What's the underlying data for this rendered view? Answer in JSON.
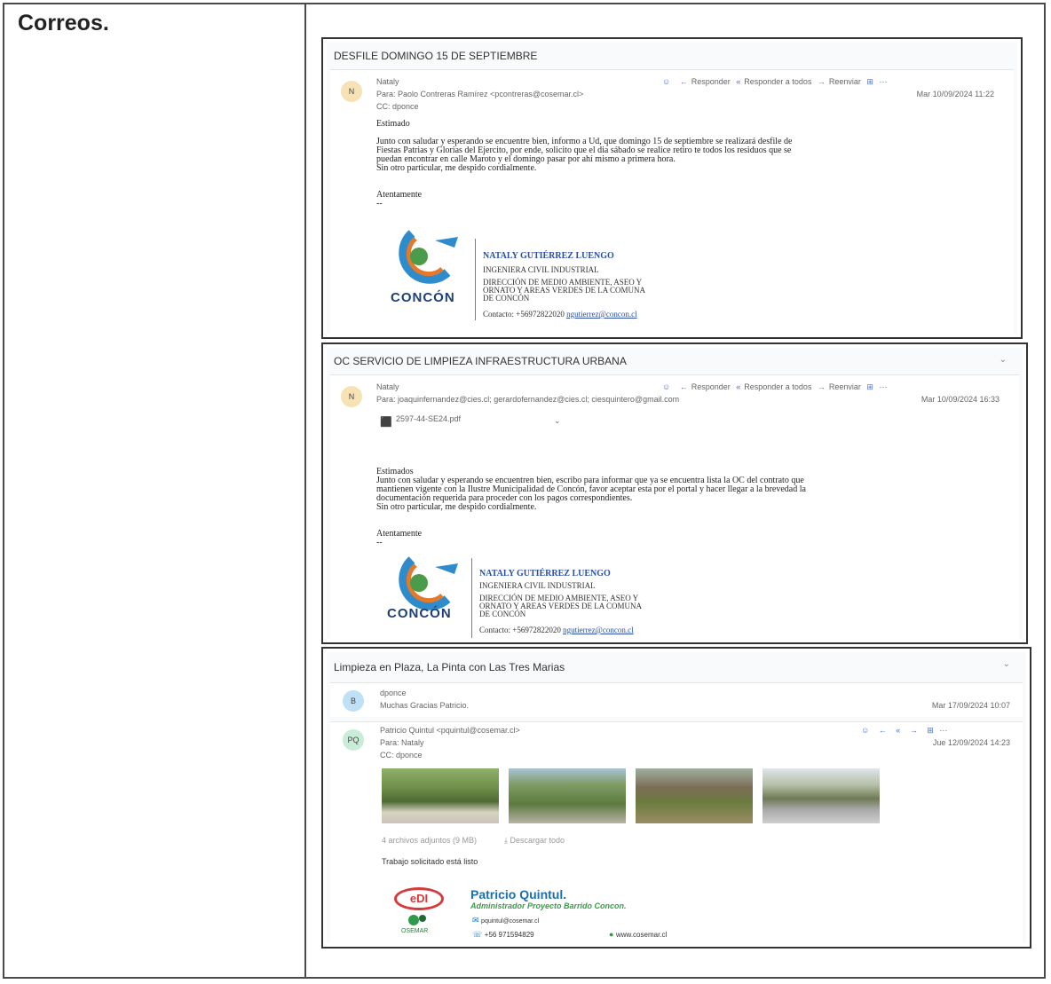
{
  "section_title": "Correos.",
  "email1": {
    "subject": "DESFILE DOMINGO 15 DE SEPTIEMBRE",
    "avatar": "N",
    "sender": "Nataly",
    "to": "Para: Paolo Contreras Ramírez <pcontreras@cosemar.cl>",
    "cc": "CC: dponce",
    "actions": [
      "Responder",
      "Responder a todos",
      "Reenviar"
    ],
    "date": "Mar 10/09/2024 11:22",
    "greeting": "Estimado",
    "body": [
      "Junto con saludar y esperando se encuentre bien, informo a Ud, que domingo 15 de septiembre se realizará desfile de",
      "Fiestas Patrias y Glorias del Ejercito, por ende, solicito que el dia sábado se realice retiro te todos los residuos que se",
      "puedan encontrar en calle Maroto y el domingo pasar por ahí mismo a primera hora.",
      "Sin otro particular, me despido cordialmente."
    ],
    "closing": "Atentamente",
    "dashes": "--"
  },
  "email2": {
    "subject": "OC SERVICIO DE LIMPIEZA INFRAESTRUCTURA URBANA",
    "avatar": "N",
    "sender": "Nataly",
    "to": "Para: joaquinfernandez@cies.cl; gerardofernandez@cies.cl; ciesquintero@gmail.com",
    "actions": [
      "Responder",
      "Responder a todos",
      "Reenviar"
    ],
    "date": "Mar 10/09/2024 16:33",
    "attachment": "2597-44-SE24.pdf",
    "greeting": "Estimados",
    "body": [
      "Junto con saludar y esperando se encuentren bien, escribo para informar que ya se encuentra lista la OC del contrato que",
      "mantienen vigente con la Ilustre Municipalidad de Concón, favor aceptar esta por el portal y hacer llegar a la brevedad la",
      "documentación requerida para proceder con los pagos correspondientes.",
      "Sin otro particular, me despido cordialmente."
    ],
    "closing": "Atentamente",
    "dashes": "--"
  },
  "signature": {
    "name": "NATALY GUTIÉRREZ LUENGO",
    "role": "INGENIERA CIVIL INDUSTRIAL",
    "dept1": "DIRECCIÓN DE MEDIO AMBIENTE, ASEO Y",
    "dept2": "ORNATO Y AREAS VERDES DE LA COMUNA",
    "dept3": "DE CONCÓN",
    "contact_label": "Contacto: +56972822020",
    "contact_email": "ngutierrez@concon.cl",
    "logo_text": "CONCÓN"
  },
  "email3": {
    "subject": "Limpieza en Plaza, La Pinta con Las Tres Marias",
    "reply_avatar": "B",
    "reply_sender": "dponce",
    "reply_preview": "Muchas Gracias Patricio.",
    "reply_date": "Mar 17/09/2024 10:07",
    "avatar": "PQ",
    "sender": "Patricio Quintul <pquintul@cosemar.cl>",
    "to": "Para: Nataly",
    "cc": "CC: dponce",
    "date": "Jue 12/09/2024 14:23",
    "attachments_info": "4 archivos adjuntos (9 MB)",
    "download_all": "Descargar todo",
    "body": "Trabajo solicitado está listo",
    "sig_name": "Patricio Quintul.",
    "sig_title": "Administrador Proyecto Barrido Concon.",
    "sig_email": "pquintul@cosemar.cl",
    "sig_phone": "+56 971594829",
    "sig_web": "www.cosemar.cl",
    "logo1": "eDI",
    "logo2": "OSEMAR"
  }
}
